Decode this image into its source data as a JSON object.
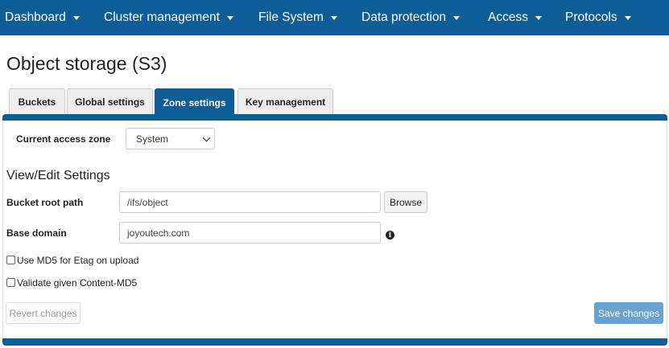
{
  "nav": {
    "items": [
      {
        "label": "Dashboard"
      },
      {
        "label": "Cluster management"
      },
      {
        "label": "File System"
      },
      {
        "label": "Data protection"
      },
      {
        "label": "Access"
      },
      {
        "label": "Protocols"
      }
    ]
  },
  "page": {
    "title": "Object storage (S3)"
  },
  "tabs": [
    {
      "label": "Buckets",
      "active": false
    },
    {
      "label": "Global settings",
      "active": false
    },
    {
      "label": "Zone settings",
      "active": true
    },
    {
      "label": "Key management",
      "active": false
    }
  ],
  "zone": {
    "label": "Current access zone",
    "selected": "System"
  },
  "section": {
    "title": "View/Edit Settings"
  },
  "bucket_root": {
    "label": "Bucket root path",
    "value": "/ifs/object",
    "browse_label": "Browse"
  },
  "base_domain": {
    "label": "Base domain",
    "value": "joyoutech.com"
  },
  "options": {
    "md5_etag": {
      "label": "Use MD5 for Etag on upload",
      "checked": false
    },
    "validate_md5": {
      "label": "Validate given Content-MD5",
      "checked": false
    }
  },
  "actions": {
    "revert_label": "Revert changes",
    "save_label": "Save changes"
  },
  "colors": {
    "nav": "#0e5d96",
    "primary_button": "#6aa3cf"
  }
}
